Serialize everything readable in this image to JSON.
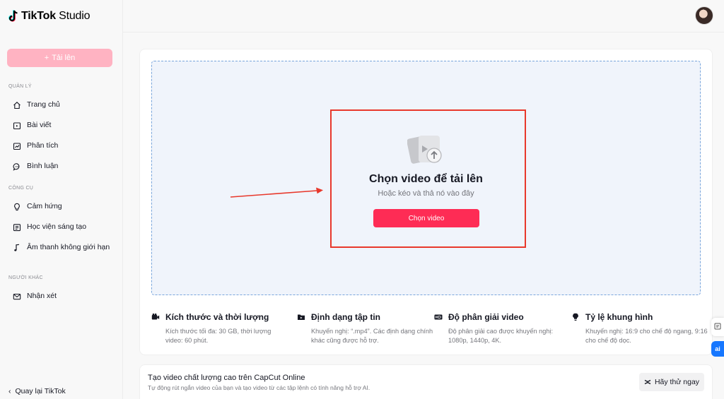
{
  "app": {
    "logo_brand": "TikTok",
    "logo_product": "Studio"
  },
  "sidebar": {
    "upload_label": "Tải lên",
    "sections": [
      {
        "label": "QUẢN LÝ",
        "items": [
          {
            "label": "Trang chủ",
            "icon": "home-icon"
          },
          {
            "label": "Bài viết",
            "icon": "posts-icon"
          },
          {
            "label": "Phân tích",
            "icon": "analytics-icon"
          },
          {
            "label": "Bình luận",
            "icon": "comment-icon"
          }
        ]
      },
      {
        "label": "CÔNG CỤ",
        "items": [
          {
            "label": "Cảm hứng",
            "icon": "lightbulb-icon"
          },
          {
            "label": "Học viện sáng tạo",
            "icon": "academy-icon"
          },
          {
            "label": "Âm thanh không giới hạn",
            "icon": "music-note-icon"
          }
        ]
      },
      {
        "label": "NGƯỜI KHÁC",
        "items": [
          {
            "label": "Nhận xét",
            "icon": "mail-icon"
          }
        ]
      }
    ],
    "back_label": "Quay lại TikTok"
  },
  "upload": {
    "title": "Chọn video để tải lên",
    "subtitle": "Hoặc kéo và thả nó vào đây",
    "button": "Chọn video"
  },
  "info": [
    {
      "title": "Kích thước và thời lượng",
      "desc": "Kích thước tối đa: 30 GB, thời lượng video: 60 phút.",
      "icon": "video-camera-icon"
    },
    {
      "title": "Định dạng tập tin",
      "desc": "Khuyến nghị: “.mp4”. Các định dạng chính khác cũng được hỗ trợ.",
      "icon": "folder-icon"
    },
    {
      "title": "Độ phân giải video",
      "desc": "Độ phân giải cao được khuyến nghị: 1080p, 1440p, 4K.",
      "icon": "hd-icon"
    },
    {
      "title": "Tỷ lệ khung hình",
      "desc": "Khuyến nghị: 16:9 cho chế độ ngang, 9:16 cho chế độ dọc.",
      "icon": "aspect-ratio-icon"
    }
  ],
  "capcut": {
    "title": "Tạo video chất lượng cao trên CapCut Online",
    "desc": "Tự động rút ngắn video của bạn và tạo video từ các tập lệnh có tính năng hỗ trợ AI.",
    "button": "Hãy thử ngay"
  },
  "floating": {
    "ai_label": "ai"
  },
  "colors": {
    "primary": "#fe2c55",
    "upload_disabled": "#ffb3c2",
    "dropzone_bg": "#f0f4fb",
    "dropzone_border": "#7aa6dc",
    "annotation_red": "#e8382b"
  }
}
